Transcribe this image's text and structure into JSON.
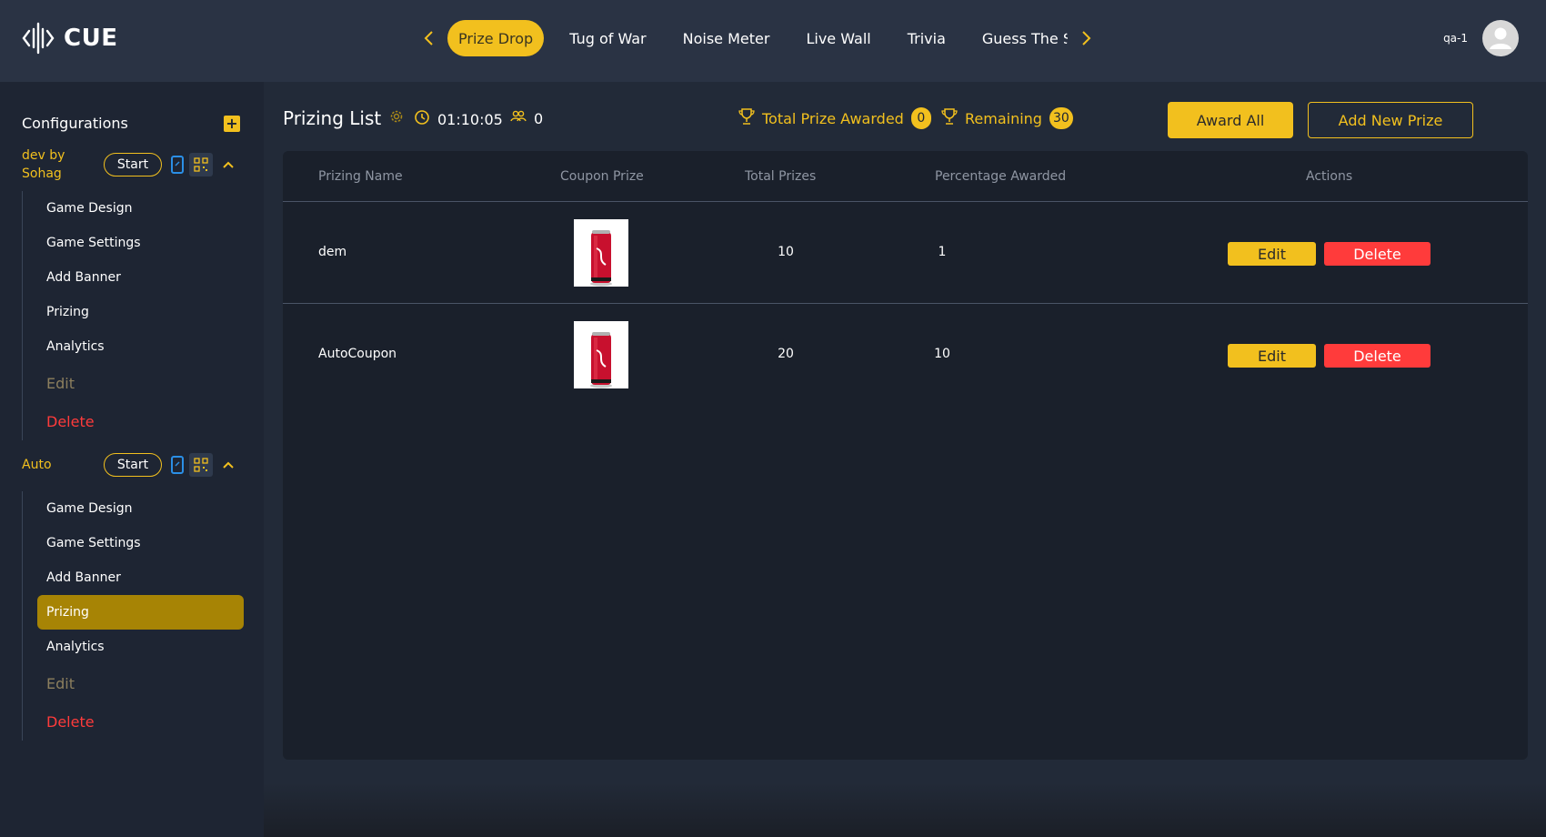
{
  "app": {
    "logo_text": "CUE"
  },
  "nav": {
    "tabs": [
      {
        "label": "Prize Drop",
        "active": true
      },
      {
        "label": "Tug of War",
        "active": false
      },
      {
        "label": "Noise Meter",
        "active": false
      },
      {
        "label": "Live Wall",
        "active": false
      },
      {
        "label": "Trivia",
        "active": false
      },
      {
        "label": "Guess The Sc",
        "active": false
      }
    ]
  },
  "user": {
    "name": "qa-1"
  },
  "sidebar": {
    "title": "Configurations",
    "configs": [
      {
        "name": "dev by Sohag",
        "start_label": "Start",
        "items": [
          "Game Design",
          "Game Settings",
          "Add Banner",
          "Prizing",
          "Analytics"
        ],
        "edit_label": "Edit",
        "delete_label": "Delete"
      },
      {
        "name": "Auto",
        "start_label": "Start",
        "items": [
          "Game Design",
          "Game Settings",
          "Add Banner",
          "Prizing",
          "Analytics"
        ],
        "active_item": "Prizing",
        "edit_label": "Edit",
        "delete_label": "Delete"
      }
    ]
  },
  "main": {
    "title": "Prizing List",
    "timer": "01:10:05",
    "players": "0",
    "total_awarded_label": "Total Prize Awarded",
    "total_awarded_value": "0",
    "remaining_label": "Remaining",
    "remaining_value": "30",
    "award_all_label": "Award All",
    "add_prize_label": "Add New Prize"
  },
  "table": {
    "columns": [
      "Prizing Name",
      "Coupon Prize",
      "Total Prizes",
      "Percentage Awarded",
      "Actions"
    ],
    "rows": [
      {
        "name": "dem",
        "total": "10",
        "percentage": "1",
        "edit": "Edit",
        "delete": "Delete"
      },
      {
        "name": "AutoCoupon",
        "total": "20",
        "percentage": "10",
        "edit": "Edit",
        "delete": "Delete"
      }
    ]
  },
  "colors": {
    "accent": "#f2c01e",
    "danger": "#ff3b3b",
    "background": "#222a38",
    "panel": "#1a202b"
  }
}
